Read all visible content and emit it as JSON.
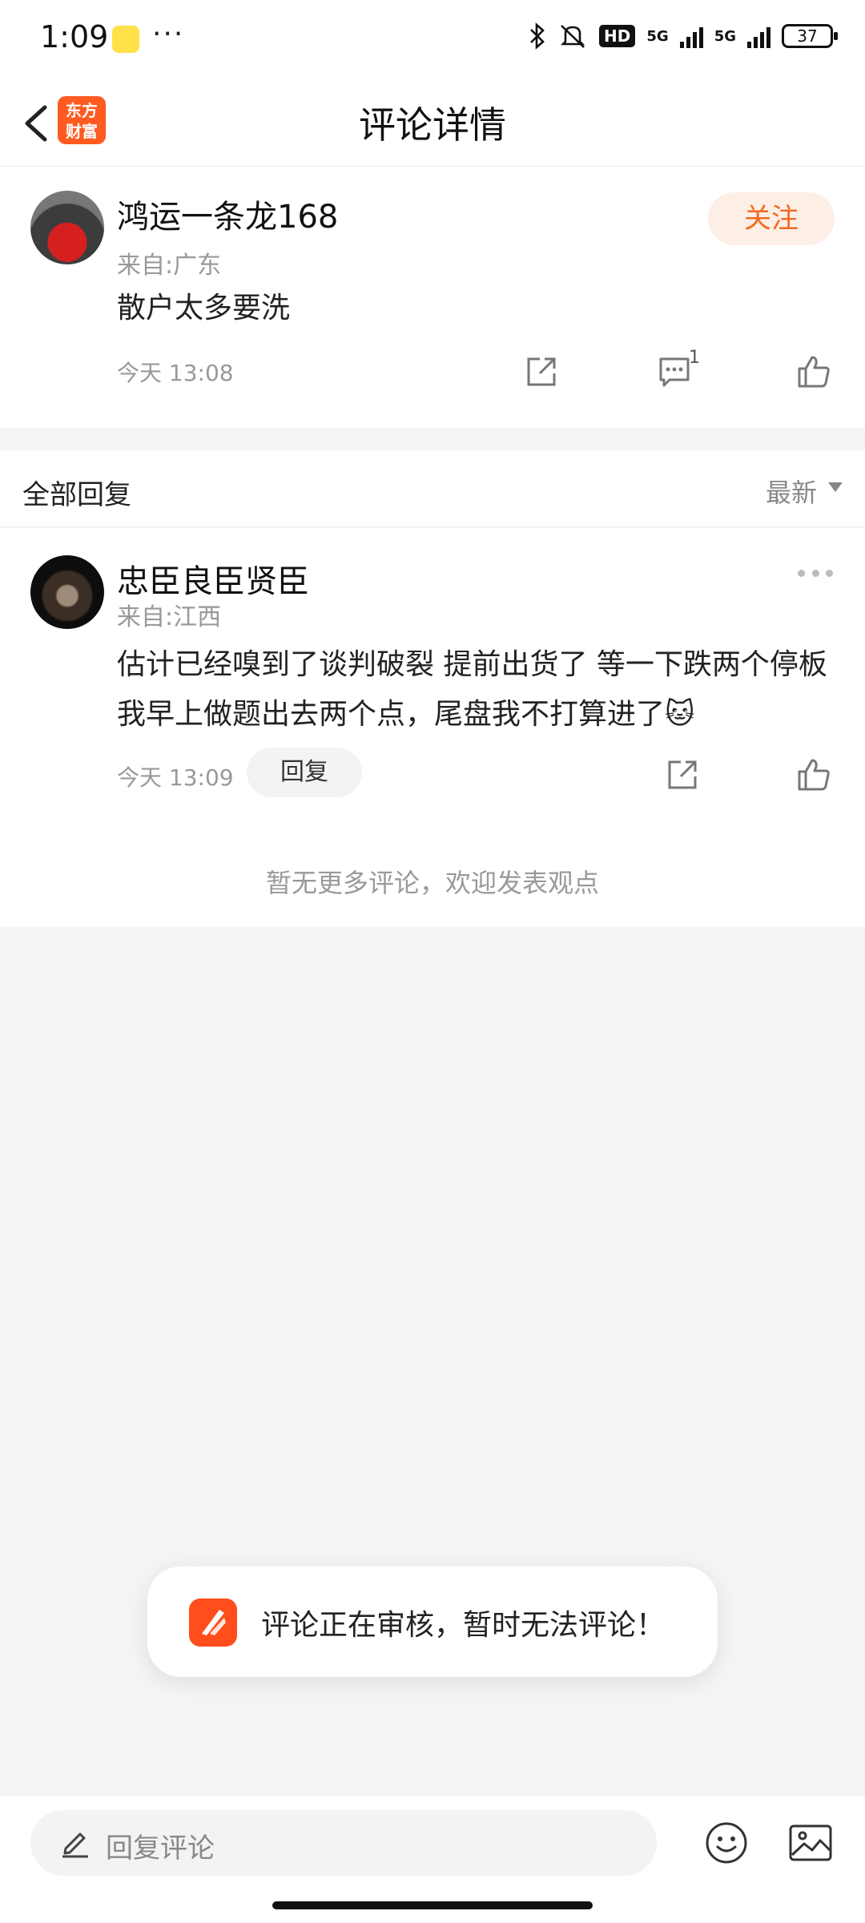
{
  "status_bar": {
    "time": "1:09",
    "dots": "···",
    "hd": "HD",
    "net1": "5G",
    "net2": "5G",
    "battery": "37"
  },
  "nav": {
    "logo_line1": "东方",
    "logo_line2": "财富",
    "title": "评论详情"
  },
  "comment": {
    "username": "鸿运一条龙168",
    "from": "来自:广东",
    "text": "散户太多要洗",
    "time": "今天 13:08",
    "follow_label": "关注",
    "reply_count": "1"
  },
  "replies_header": {
    "title": "全部回复",
    "sort": "最新"
  },
  "reply": {
    "username": "忠臣良臣贤臣",
    "from": "来自:江西",
    "text": "估计已经嗅到了谈判破裂 提前出货了 等一下跌两个停板 我早上做题出去两个点，尾盘我不打算进了",
    "emoji": "🐱",
    "time": "今天 13:09",
    "reply_label": "回复"
  },
  "no_more_text": "暂无更多评论，欢迎发表观点",
  "toast": {
    "text": "评论正在审核，暂时无法评论！"
  },
  "bottom": {
    "placeholder": "回复评论"
  },
  "colors": {
    "accent": "#f16a1e",
    "brand": "#ff5a1f"
  }
}
